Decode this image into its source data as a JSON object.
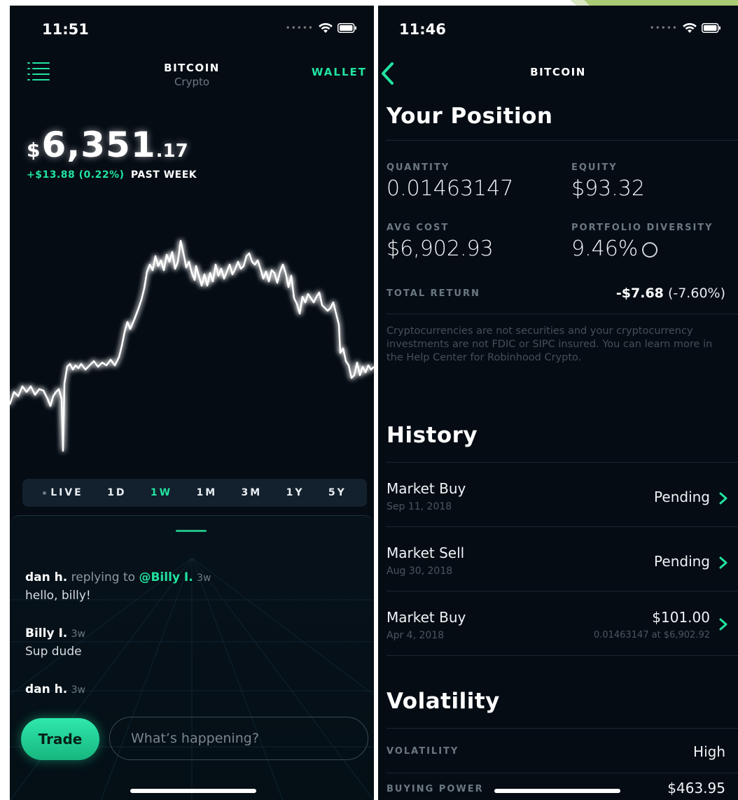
{
  "colors": {
    "background": "#050c14",
    "accent": "#22e3a0",
    "muted": "#6f7880"
  },
  "left": {
    "status_time": "11:51",
    "header": {
      "title": "BITCOIN",
      "subtitle": "Crypto",
      "wallet_label": "WALLET"
    },
    "price": {
      "currency": "$",
      "main": "6,351",
      "cents": ".17"
    },
    "change": {
      "delta": "+$13.88 (0.22%)",
      "period": "PAST WEEK"
    },
    "ranges": [
      "LIVE",
      "1D",
      "1W",
      "1M",
      "3M",
      "1Y",
      "5Y"
    ],
    "active_range": "1W",
    "messages": [
      {
        "author": "dan h.",
        "replying_text": "replying to",
        "mention": "@Billy I.",
        "time": "3w",
        "body": "hello, billy!"
      },
      {
        "author": "Billy I.",
        "time": "3w",
        "body": "Sup dude"
      },
      {
        "author": "dan h.",
        "time": "3w"
      }
    ],
    "trade_label": "Trade",
    "composer_placeholder": "What’s happening?"
  },
  "right": {
    "status_time": "11:46",
    "title": "BITCOIN",
    "position": {
      "heading": "Your Position",
      "quantity_label": "QUANTITY",
      "quantity": "0.01463147",
      "equity_label": "EQUITY",
      "equity": "$93.32",
      "avg_cost_label": "AVG COST",
      "avg_cost": "$6,902.93",
      "diversity_label": "PORTFOLIO DIVERSITY",
      "diversity": "9.46%",
      "total_return_label": "TOTAL RETURN",
      "total_return_amount": "-$7.68",
      "total_return_pct": "(-7.60%)"
    },
    "disclaimer": "Cryptocurrencies are not securities and your cryptocurrency investments are not FDIC or SIPC insured. You can learn more in the Help Center for Robinhood Crypto.",
    "history": {
      "heading": "History",
      "items": [
        {
          "name": "Market Buy",
          "date": "Sep 11, 2018",
          "status": "Pending"
        },
        {
          "name": "Market Sell",
          "date": "Aug 30, 2018",
          "status": "Pending"
        },
        {
          "name": "Market Buy",
          "date": "Apr 4, 2018",
          "status": "$101.00",
          "detail": "0.01463147 at $6,902.92"
        }
      ]
    },
    "volatility": {
      "heading": "Volatility",
      "volatility_label": "VOLATILITY",
      "volatility_value": "High",
      "buying_power_label": "BUYING POWER",
      "buying_power_value": "$463.95"
    }
  }
}
